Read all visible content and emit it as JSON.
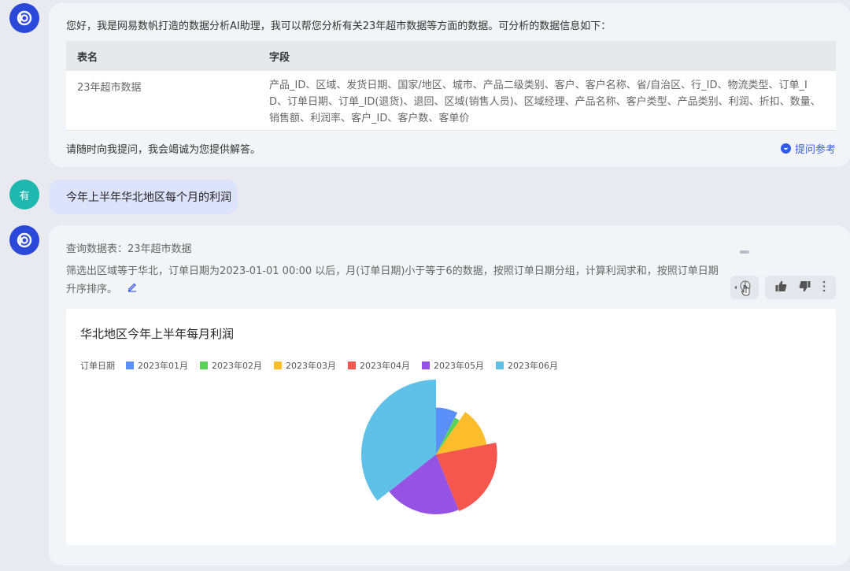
{
  "bot_avatar": {
    "icon": "brand-logo-icon",
    "color": "#2a49d9"
  },
  "user_avatar": {
    "text": "有",
    "color": "#1fb8ae"
  },
  "greeting": {
    "intro": "您好，我是网易数帆打造的数据分析AI助理，我可以帮您分析有关23年超市数据等方面的数据。可分析的数据信息如下：",
    "table": {
      "headers": [
        "表名",
        "字段"
      ],
      "rows": [
        {
          "name": "23年超市数据",
          "fields": "产品_ID、区域、发货日期、国家/地区、城市、产品二级类别、客户、客户名称、省/自治区、行_ID、物流类型、订单_ID、订单日期、订单_ID(退货)、退回、区域(销售人员)、区域经理、产品名称、客户类型、产品类别、利润、折扣、数量、销售额、利润率、客户_ID、客户数、客单价"
        }
      ]
    },
    "outro": "请随时向我提问，我会竭诚为您提供解答。",
    "reference_link": "提问参考"
  },
  "user_message": "今年上半年华北地区每个月的利润",
  "answer": {
    "query_table": "查询数据表：23年超市数据",
    "query_desc": "筛选出区域等于华北，订单日期为2023-01-01 00:00 以后，月(订单日期)小于等于6的数据，按照订单日期分组，计算利润求和，按照订单日期升序排序。",
    "toolbar_icons": [
      "view-toggle-icon",
      "thumbs-up-icon",
      "thumbs-down-icon",
      "more-icon"
    ]
  },
  "chart_data": {
    "type": "pie",
    "title": "华北地区今年上半年每月利润",
    "legend_title": "订单日期",
    "legend_position": "top-left",
    "categories": [
      "2023年01月",
      "2023年02月",
      "2023年03月",
      "2023年04月",
      "2023年05月",
      "2023年06月"
    ],
    "values": [
      5.5,
      1.5,
      9,
      16,
      15,
      26
    ],
    "colors": [
      "#5b8ff9",
      "#5ad25a",
      "#fbbd2c",
      "#f5574e",
      "#9552e3",
      "#5fc0e8"
    ],
    "radius_style": "rose"
  }
}
